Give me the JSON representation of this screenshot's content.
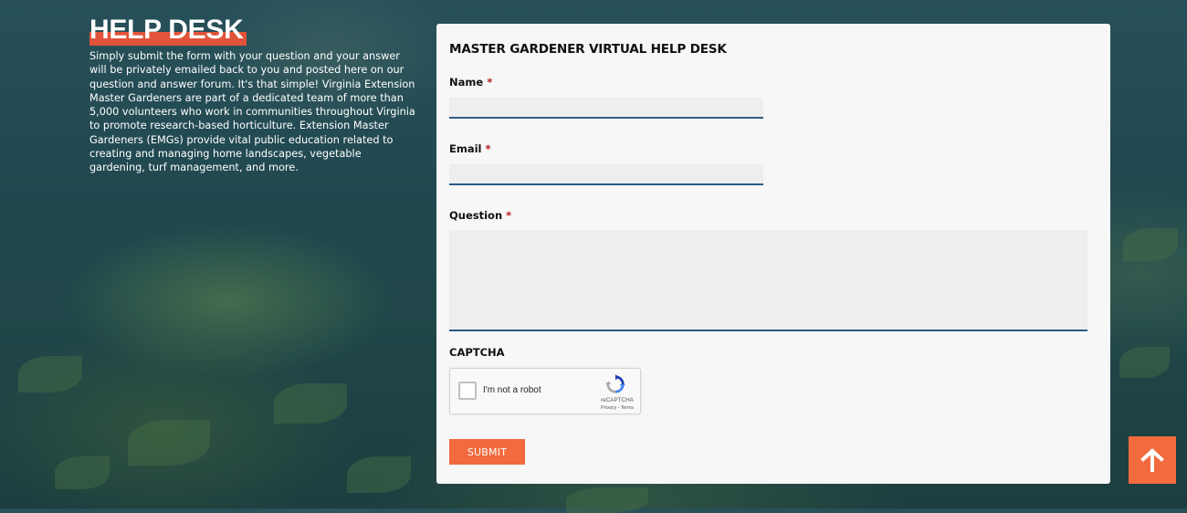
{
  "intro": {
    "title": "HELP DESK",
    "body": "Simply submit the form with your question and your answer will be privately emailed back to you and posted here on our question and answer forum. It's that simple! Virginia Extension Master Gardeners are part of a dedicated team of more than 5,000 volunteers who work in communities throughout Virginia to promote research-based horticulture. Extension Master Gardeners (EMGs) provide vital public education related to creating and managing home landscapes, vegetable gardening, turf management, and more."
  },
  "form": {
    "heading": "MASTER GARDENER VIRTUAL HELP DESK",
    "required_marker": "*",
    "name": {
      "label": "Name",
      "value": ""
    },
    "email": {
      "label": "Email",
      "value": ""
    },
    "question": {
      "label": "Question",
      "value": ""
    },
    "captcha": {
      "label": "CAPTCHA",
      "checkbox_label": "I'm not a robot",
      "brand": "reCAPTCHA",
      "links": "Privacy - Terms",
      "checked": false
    },
    "submit_label": "SUBMIT"
  },
  "scroll_top": {
    "icon": "arrow-up-icon"
  },
  "colors": {
    "accent": "#f26a3d",
    "title_highlight": "#e1533a",
    "input_border": "#2b5b85",
    "required": "#b3191d"
  }
}
